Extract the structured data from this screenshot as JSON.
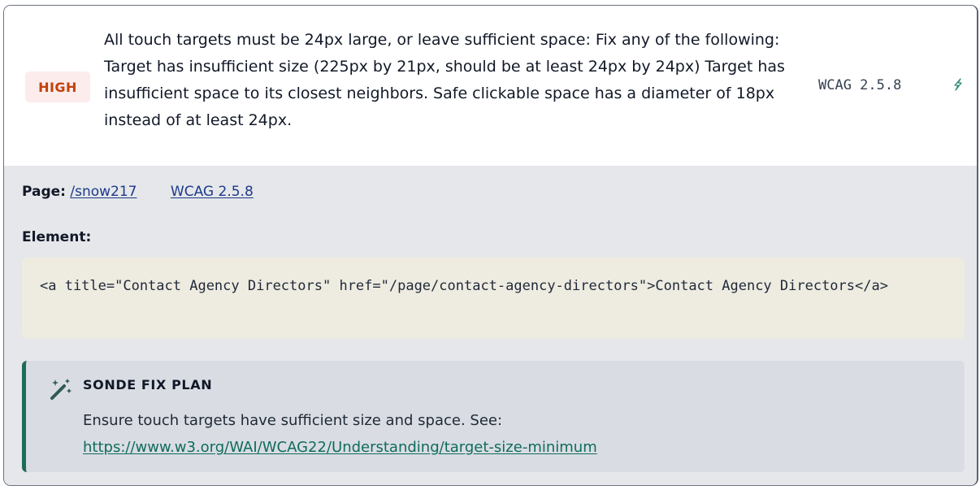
{
  "issue": {
    "severity": "HIGH",
    "description": "All touch targets must be 24px large, or leave sufficient space: Fix any of the following: Target has insufficient size (225px by 21px, should be at least 24px by 24px) Target has insufficient space to its closest neighbors. Safe clickable space has a diameter of 18px instead of at least 24px.",
    "wcag_ref": "WCAG 2.5.8",
    "fix_icon": "lightning-icon"
  },
  "details": {
    "page_label": "Page:",
    "page_link": "/snow217",
    "wcag_link": "WCAG 2.5.8",
    "element_label": "Element:",
    "element_code": "<a title=\"Contact Agency Directors\" href=\"/page/contact-agency-directors\">Contact Agency Directors</a>"
  },
  "fix_plan": {
    "icon": "magic-wand-icon",
    "title": "SONDE FIX PLAN",
    "text": "Ensure touch targets have sufficient size and space. See:",
    "link": "https://www.w3.org/WAI/WCAG22/Understanding/target-size-minimum"
  },
  "colors": {
    "severity_text": "#c2410c",
    "severity_bg": "#fdecec",
    "link": "#1e3a8a",
    "fix_link": "#0f6b5c",
    "fix_accent": "#1e6b5b",
    "code_bg": "#eeebe1",
    "details_bg": "#e5e7ea"
  }
}
